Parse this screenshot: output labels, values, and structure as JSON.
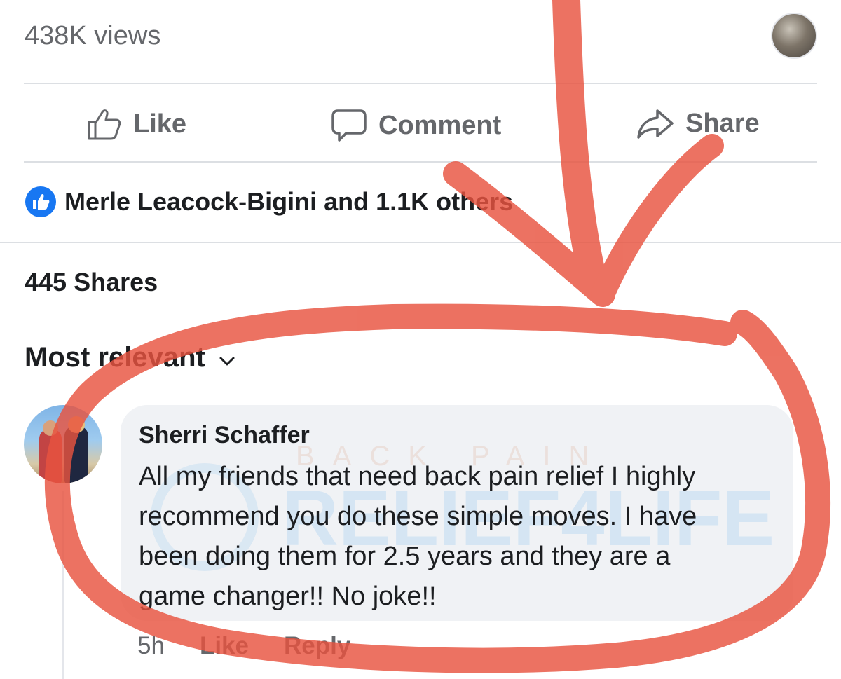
{
  "post": {
    "views": "438K views",
    "actions": {
      "like": "Like",
      "comment": "Comment",
      "share": "Share"
    },
    "reactions_text": "Merle Leacock-Bigini and 1.1K others",
    "shares_count": "445 Shares",
    "sort_label": "Most relevant"
  },
  "comment": {
    "author": "Sherri Schaffer",
    "text": "All my friends that need back pain relief I highly\nrecommend you do these simple moves. I have\nbeen doing them for 2.5 years and they are a\ngame changer!!  No joke!!",
    "time": "5h",
    "like_label": "Like",
    "reply_label": "Reply",
    "watermark_top": "BACK PAIN",
    "watermark_main": "RELIEF4LIFE"
  },
  "colors": {
    "facebook_blue": "#1877f2",
    "secondary_text": "#65676b",
    "bubble_bg": "#f0f2f5",
    "annotation_red": "#e8533f"
  },
  "icons": [
    "viewer-avatar",
    "thumbs-up-icon",
    "speech-bubble-icon",
    "share-arrow-icon",
    "like-badge-icon",
    "chevron-down-icon"
  ]
}
